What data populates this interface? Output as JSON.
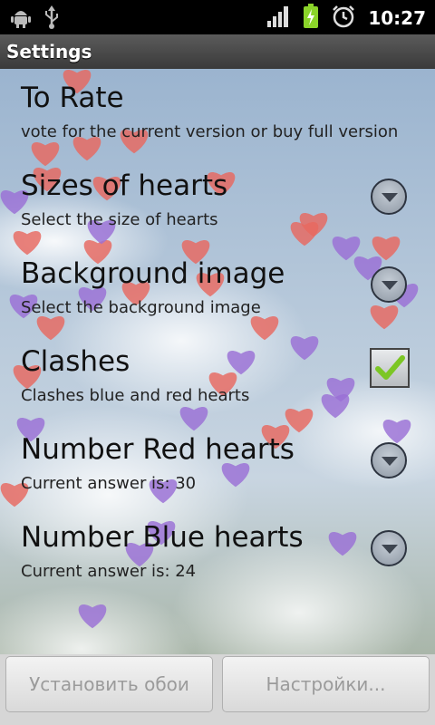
{
  "status_bar": {
    "time": "10:27",
    "left_icons": [
      "android-debug-icon",
      "usb-icon"
    ],
    "right_icons": [
      "signal-icon",
      "battery-charging-icon",
      "alarm-clock-icon"
    ]
  },
  "title_bar": {
    "title": "Settings"
  },
  "preferences": [
    {
      "title": "To Rate",
      "summary": "vote for the current version or buy full version",
      "widget": "none"
    },
    {
      "title": "Sizes of hearts",
      "summary": "Select the size of hearts",
      "widget": "dropdown-arrow"
    },
    {
      "title": "Background image",
      "summary": "Select the background image",
      "widget": "dropdown-arrow"
    },
    {
      "title": "Clashes",
      "summary": "Clashes blue and red hearts",
      "widget": "checkbox",
      "checked": true
    },
    {
      "title": "Number Red hearts",
      "summary": "Current answer is: 30",
      "widget": "dropdown-arrow"
    },
    {
      "title": "Number Blue hearts",
      "summary": "Current answer is: 24",
      "widget": "dropdown-arrow"
    }
  ],
  "buttons": {
    "set_wallpaper": "Установить обои",
    "settings": "Настройки..."
  },
  "colors": {
    "red_heart": "#e8685f",
    "blue_heart": "#9a6fd6",
    "check_green": "#8bd42a",
    "title_bar": "#4a4a4a"
  }
}
